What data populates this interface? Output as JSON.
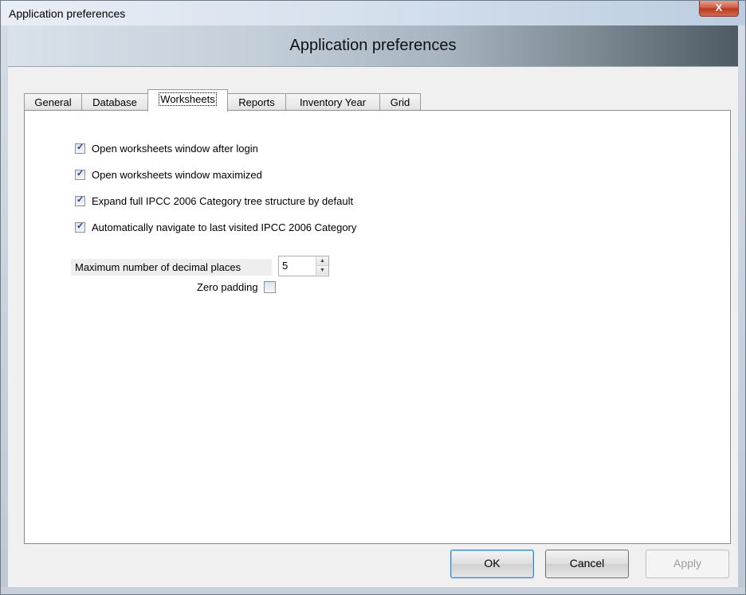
{
  "window": {
    "title": "Application preferences",
    "close_glyph": "X"
  },
  "banner": {
    "title": "Application preferences"
  },
  "tabs": [
    {
      "label": "General",
      "active": false
    },
    {
      "label": "Database",
      "active": false
    },
    {
      "label": "Worksheets",
      "active": true
    },
    {
      "label": "Reports",
      "active": false
    },
    {
      "label": "Inventory Year",
      "active": false
    },
    {
      "label": "Grid",
      "active": false
    }
  ],
  "options": [
    {
      "label": "Open worksheets window after login",
      "checked": true
    },
    {
      "label": "Open worksheets window maximized",
      "checked": true
    },
    {
      "label": "Expand full IPCC 2006 Category tree structure by default",
      "checked": true
    },
    {
      "label": "Automatically navigate to last visited IPCC 2006 Category",
      "checked": true
    }
  ],
  "decimal_places": {
    "label": "Maximum number of decimal places",
    "value": "5"
  },
  "zero_padding": {
    "label": "Zero padding",
    "checked": false
  },
  "buttons": {
    "ok": "OK",
    "cancel": "Cancel",
    "apply": "Apply"
  },
  "icons": {
    "close": "close-icon",
    "spin_up": "arrow-up-icon",
    "spin_down": "arrow-down-icon"
  }
}
